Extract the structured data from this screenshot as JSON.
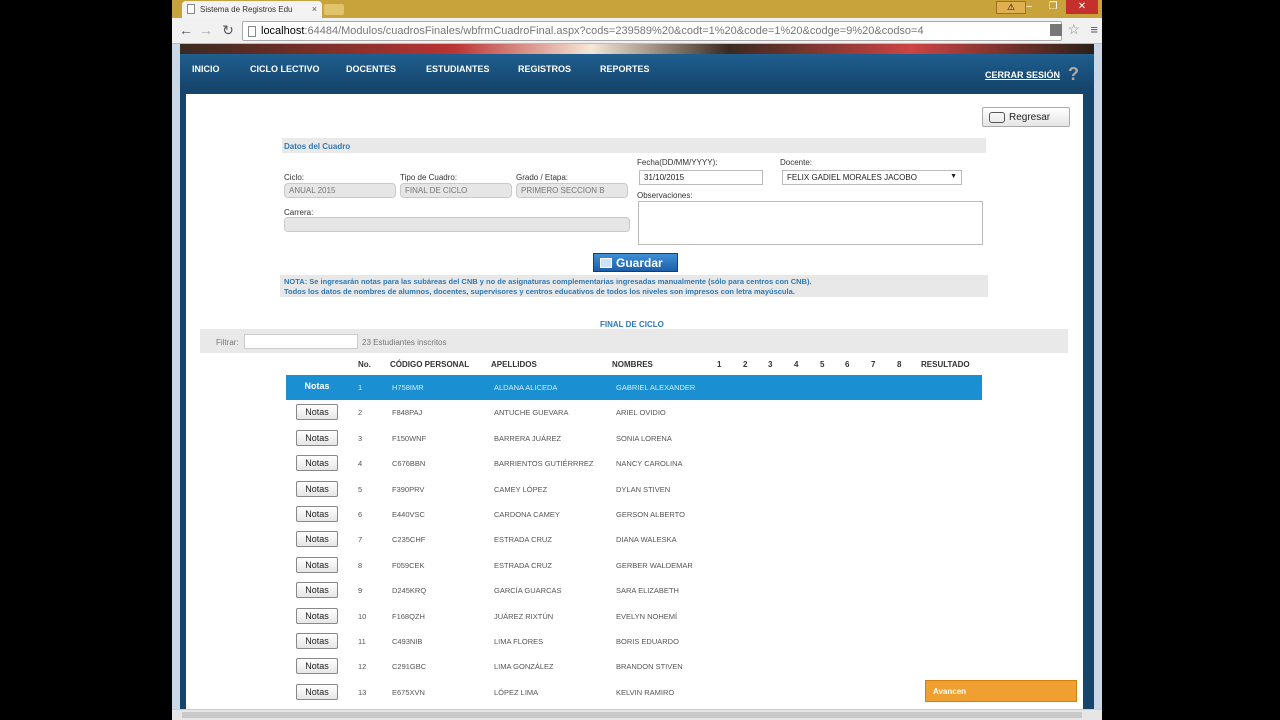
{
  "browser": {
    "tab_title": "Sistema de Registros Edu",
    "tab_close": "×",
    "url_host": "localhost",
    "url_rest": ":64484/Modulos/cuadrosFinales/wbfrmCuadroFinal.aspx?cods=239589%20&codt=1%20&code=1%20&codge=9%20&codso=4"
  },
  "nav": {
    "items": [
      "INICIO",
      "CICLO LECTIVO",
      "DOCENTES",
      "ESTUDIANTES",
      "REGISTROS",
      "REPORTES"
    ],
    "logout": "CERRAR SESIÓN",
    "help": "?"
  },
  "back_button": "Regresar",
  "section_title": "Datos del Cuadro",
  "form": {
    "ciclo_label": "Ciclo:",
    "ciclo_value": "ANUAL 2015",
    "tipo_label": "Tipo de Cuadro:",
    "tipo_value": "FINAL DE CICLO",
    "grado_label": "Grado / Etapa:",
    "grado_value": "PRIMERO SECCION B",
    "carrera_label": "Carrera:",
    "carrera_value": "",
    "fecha_label": "Fecha(DD/MM/YYYY):",
    "fecha_value": "31/10/2015",
    "docente_label": "Docente:",
    "docente_value": "FELIX GADIEL MORALES JACOBO",
    "obs_label": "Observaciones:"
  },
  "save_button": "Guardar",
  "note_line1": "NOTA: Se ingresarán notas para las subáreas del CNB y no de asignaturas complementarias ingresadas manualmente (sólo para centros con CNB).",
  "note_line2": "Todos los datos de nombres de alumnos, docentes, supervisores y centros educativos de todos los niveles son impresos con letra mayúscula.",
  "grid": {
    "title": "FINAL DE CICLO",
    "filter_label": "Filtrar:",
    "count": "23 Estudiantes inscritos",
    "headers": {
      "no": "No.",
      "code": "CÓDIGO PERSONAL",
      "last": "APELLIDOS",
      "first": "NOMBRES",
      "g1": "1",
      "g2": "2",
      "g3": "3",
      "g4": "4",
      "g5": "5",
      "g6": "6",
      "g7": "7",
      "g8": "8",
      "result": "RESULTADO"
    },
    "button_label": "Notas",
    "rows": [
      {
        "no": "1",
        "code": "H758IMR",
        "last": "ALDANA ALICEDA",
        "first": "GABRIEL ALEXANDER"
      },
      {
        "no": "2",
        "code": "F848PAJ",
        "last": "ANTUCHE GUEVARA",
        "first": "ARIEL OVIDIO"
      },
      {
        "no": "3",
        "code": "F150WNF",
        "last": "BARRERA JUÁREZ",
        "first": "SONIA LORENA"
      },
      {
        "no": "4",
        "code": "C676BBN",
        "last": "BARRIENTOS GUTIÉRRREZ",
        "first": "NANCY CAROLINA"
      },
      {
        "no": "5",
        "code": "F390PRV",
        "last": "CAMEY LÓPEZ",
        "first": "DYLAN STIVEN"
      },
      {
        "no": "6",
        "code": "E440VSC",
        "last": "CARDONA CAMEY",
        "first": "GERSON ALBERTO"
      },
      {
        "no": "7",
        "code": "C235CHF",
        "last": "ESTRADA CRUZ",
        "first": "DIANA WALESKA"
      },
      {
        "no": "8",
        "code": "F059CEK",
        "last": "ESTRADA CRUZ",
        "first": "GERBER WALDEMAR"
      },
      {
        "no": "9",
        "code": "D245KRQ",
        "last": "GARCÍA GUARCAS",
        "first": "SARA ELIZABETH"
      },
      {
        "no": "10",
        "code": "F168QZH",
        "last": "JUÁREZ RIXTÚN",
        "first": "EVELYN NOHEMÍ"
      },
      {
        "no": "11",
        "code": "C493NIB",
        "last": "LIMA FLORES",
        "first": "BORIS EDUARDO"
      },
      {
        "no": "12",
        "code": "C291GBC",
        "last": "LIMA GONZÁLEZ",
        "first": "BRANDON STIVEN"
      },
      {
        "no": "13",
        "code": "E675XVN",
        "last": "LÓPEZ LIMA",
        "first": "KELVIN RAMIRO"
      }
    ]
  },
  "advice_box": "Avancen",
  "colors": {
    "nav_bg": "#15456c",
    "accent_blue": "#2f79b5",
    "selected_row": "#1a8fd2",
    "advice_orange": "#f0a030"
  }
}
